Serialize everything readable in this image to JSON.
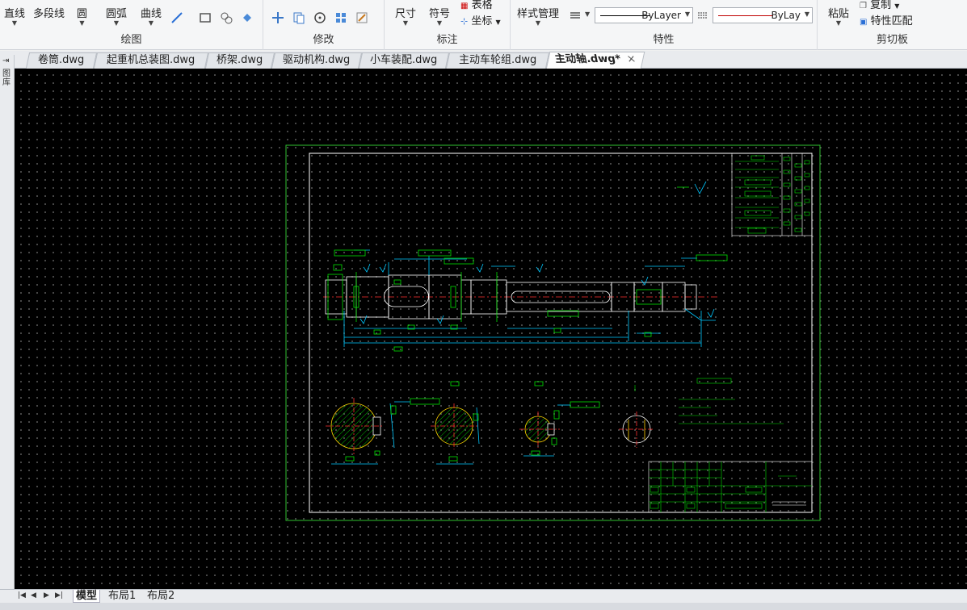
{
  "ribbon": {
    "draw": {
      "label": "绘图",
      "line": "直线",
      "polyline": "多段线",
      "circle": "圆",
      "arc": "圆弧",
      "curve": "曲线"
    },
    "modify": {
      "label": "修改"
    },
    "annotate": {
      "label": "标注",
      "dimension": "尺寸",
      "symbol": "符号",
      "table": "表格",
      "coordinate": "坐标"
    },
    "properties": {
      "label": "特性",
      "style_manager": "样式管理",
      "linetype_value": "ByLayer",
      "lineweight_value": "ByLay",
      "linetype_color": "#000000",
      "lineweight_color": "#c00000"
    },
    "clipboard": {
      "label": "剪切板",
      "paste": "粘贴",
      "copy": "复制",
      "match": "特性匹配"
    }
  },
  "file_tabs": [
    {
      "label": "卷筒.dwg",
      "active": false
    },
    {
      "label": "起重机总装图.dwg",
      "active": false
    },
    {
      "label": "桥架.dwg",
      "active": false
    },
    {
      "label": "驱动机构.dwg",
      "active": false
    },
    {
      "label": "小车装配.dwg",
      "active": false
    },
    {
      "label": "主动车轮组.dwg",
      "active": false
    },
    {
      "label": "主动轴.dwg*",
      "active": true
    }
  ],
  "file_tab_close": "×",
  "left_panel": {
    "label": "图库"
  },
  "layout_tabs": [
    {
      "label": "模型",
      "active": true
    },
    {
      "label": "布局1",
      "active": false
    },
    {
      "label": "布局2",
      "active": false
    }
  ],
  "nav_buttons": [
    "|◀",
    "◀",
    "▶",
    "▶|"
  ],
  "drawing": {
    "colors": {
      "background": "#000000",
      "frame_outer": "#2fbf2f",
      "frame_inner": "#ffffff",
      "geometry": "#00e000",
      "dimension": "#00c8ff",
      "centerline": "#ff3030",
      "hatch": "#ffd000",
      "text": "#00ff00"
    }
  }
}
